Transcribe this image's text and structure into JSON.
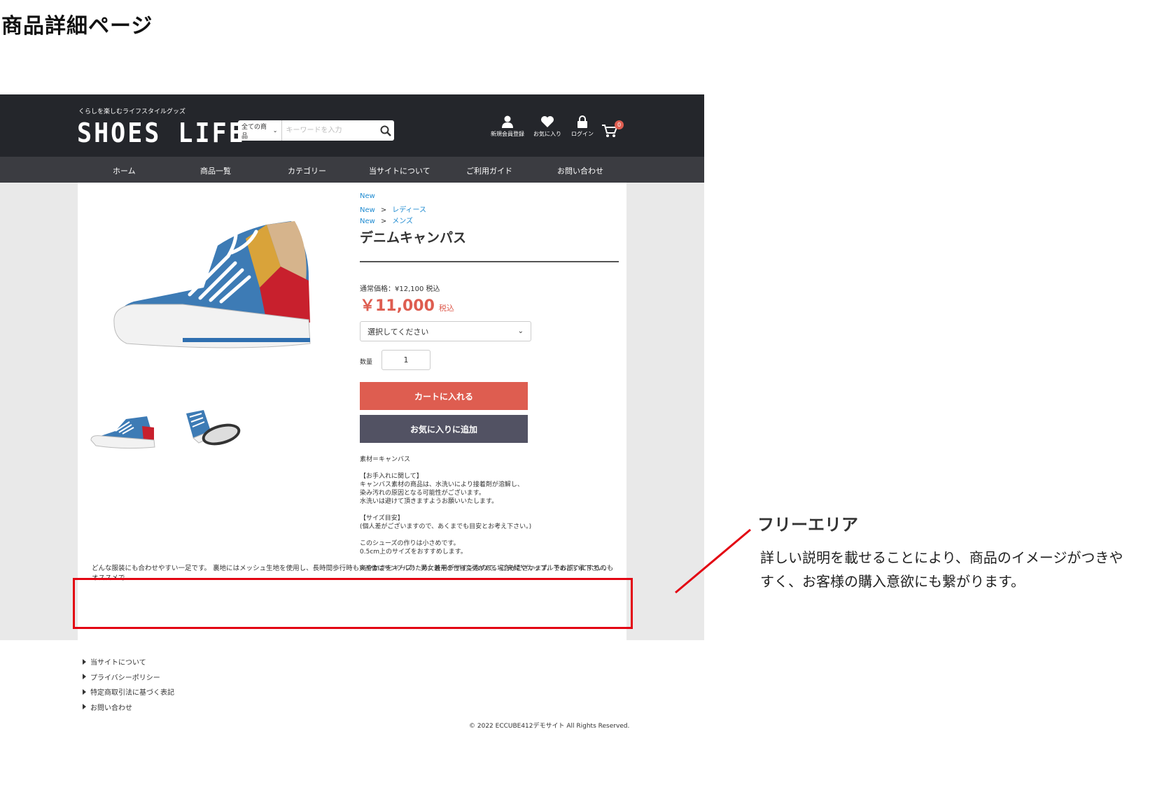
{
  "page_title": "商品詳細ページ",
  "header": {
    "tagline": "くらしを楽しむライフスタイルグッズ",
    "logo": "SHOES LIFE",
    "search_category": "全ての商品",
    "search_placeholder": "キーワードを入力",
    "icons": {
      "register": "新規会員登録",
      "favorite": "お気に入り",
      "login": "ログイン"
    },
    "cart_count": "0"
  },
  "nav": [
    "ホーム",
    "商品一覧",
    "カテゴリー",
    "当サイトについて",
    "ご利用ガイド",
    "お問い合わせ"
  ],
  "product": {
    "breadcrumbs": [
      {
        "parent": "New",
        "child": ""
      },
      {
        "parent": "New",
        "child": "レディース"
      },
      {
        "parent": "New",
        "child": "メンズ"
      }
    ],
    "name": "デニムキャンパス",
    "regular_price": "通常価格：¥12,100 税込",
    "price": "￥11,000",
    "tax": "税込",
    "select_placeholder": "選択してください",
    "qty_label": "数量",
    "qty_value": "1",
    "cart_button": "カートに入れる",
    "fav_button": "お気に入りに追加",
    "description": [
      "素材＝キャンバス",
      "【お手入れに関して】",
      "キャンバス素材の商品は、水洗いにより接着剤が溶解し、",
      "染み汚れの原因となる可能性がございます。",
      "水洗いは避けて頂きますようお願いいたします。",
      "【サイズ目安】",
      "(個人差がございますので、あくまでも目安とお考え下さい。)",
      "このシューズの作りは小さめです。",
      "0.5cm上のサイズをおすすめします。",
      "※画像はサンプルのため、若干の仕様変更がある場合がございます。予めご了承下さい。"
    ],
    "free_area": "どんな服装にも合わせやすい一足です。 裏地にはメッシュ生地を使用し、長時間歩行時も爽やかさをキープ！ 男女兼用デザインなので、ご夫婦やカップルでお揃いにするのもオススメで"
  },
  "annotation": {
    "title": "フリーエリア",
    "body": "詳しい説明を載せることにより、商品のイメージがつきやすく、お客様の購入意欲にも繋がります。"
  },
  "footer": {
    "links": [
      "当サイトについて",
      "プライバシーポリシー",
      "特定商取引法に基づく表記",
      "お問い合わせ"
    ],
    "copyright": "© 2022 ECCUBE412デモサイト All Rights Reserved."
  },
  "colors": {
    "header_bg": "#24262b",
    "nav_bg": "#3b3c41",
    "accent_red": "#de5d50",
    "fav_button": "#525263",
    "link_blue": "#1f8bd1",
    "highlight_red": "#e30613"
  }
}
